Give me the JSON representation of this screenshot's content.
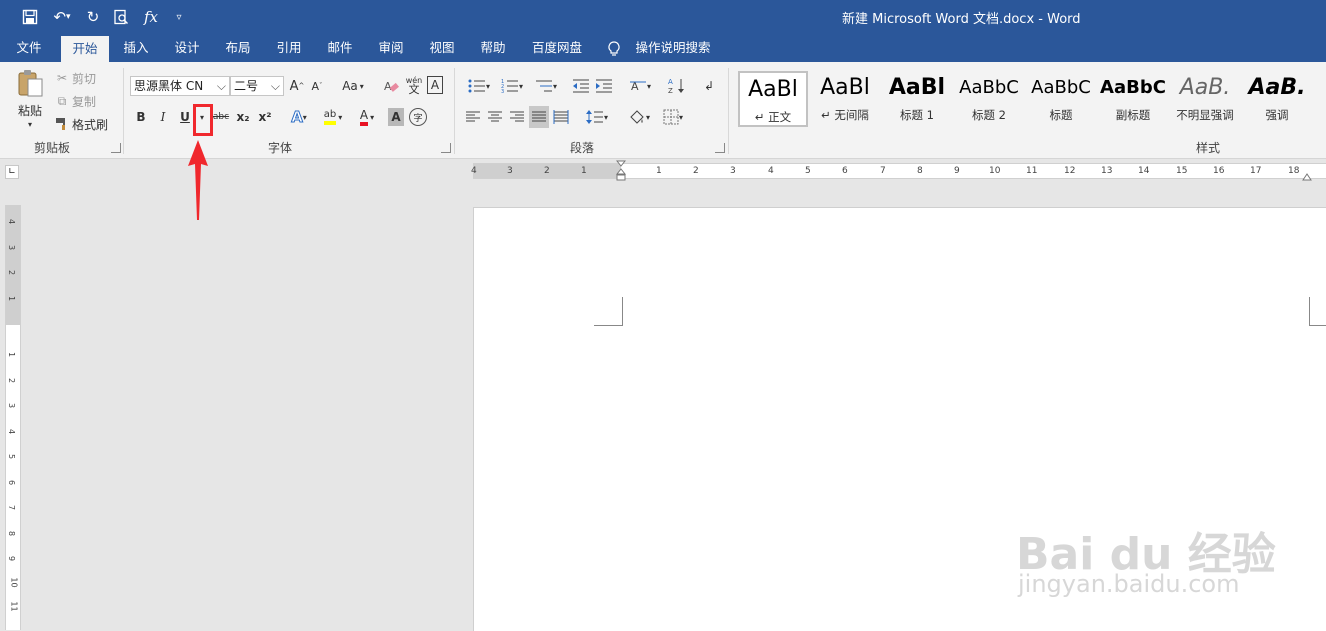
{
  "window": {
    "title": "新建 Microsoft Word 文档.docx  -  Word"
  },
  "qat": {
    "fx_label": "fx"
  },
  "tabs": [
    "文件",
    "开始",
    "插入",
    "设计",
    "布局",
    "引用",
    "邮件",
    "审阅",
    "视图",
    "帮助",
    "百度网盘"
  ],
  "tell_me": "操作说明搜索",
  "clipboard": {
    "paste": "粘贴",
    "cut": "剪切",
    "copy": "复制",
    "format_painter": "格式刷",
    "group_label": "剪贴板"
  },
  "font": {
    "font_name": "思源黑体 CN",
    "font_size": "二号",
    "grow": "A",
    "shrink": "A",
    "change_case": "Aa",
    "phonetic": "wén",
    "border_char": "A",
    "bold": "B",
    "italic": "I",
    "underline": "U",
    "strikethrough": "abc",
    "subscript": "x₂",
    "superscript": "x²",
    "text_effects": "A",
    "highlight": "ab",
    "font_color": "A",
    "char_shading": "A",
    "enclose": "字",
    "group_label": "字体"
  },
  "paragraph": {
    "group_label": "段落"
  },
  "styles": {
    "group_label": "样式",
    "items": [
      {
        "preview": "AaBl",
        "name": "↵ 正文"
      },
      {
        "preview": "AaBl",
        "name": "↵ 无间隔"
      },
      {
        "preview": "AaBl",
        "name": "标题 1"
      },
      {
        "preview": "AaBbC",
        "name": "标题 2"
      },
      {
        "preview": "AaBbC",
        "name": "标题"
      },
      {
        "preview": "AaBbC",
        "name": "副标题"
      },
      {
        "preview": "AaB.",
        "name": "不明显强调"
      },
      {
        "preview": "AaB.",
        "name": "强调"
      }
    ]
  },
  "ruler": {
    "h_left": [
      "4",
      "3",
      "2",
      "1"
    ],
    "h_right": [
      "1",
      "2",
      "3",
      "4",
      "5",
      "6",
      "7",
      "8",
      "9",
      "10",
      "11",
      "12",
      "13",
      "14",
      "15",
      "16",
      "17",
      "18"
    ],
    "v_top": [
      "4",
      "3",
      "2",
      "1"
    ],
    "v_bottom": [
      "1",
      "2",
      "3",
      "4",
      "5",
      "6",
      "7",
      "8",
      "9",
      "10",
      "11"
    ]
  },
  "watermark": {
    "logo": "Bai du 经验",
    "url": "jingyan.baidu.com"
  },
  "colors": {
    "brand": "#2b579a",
    "highlight": "#f0282d",
    "text_highlight": "#ffff00",
    "font_color": "#e81123"
  }
}
